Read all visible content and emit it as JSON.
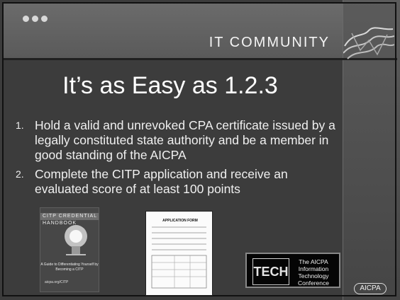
{
  "header": {
    "section_title": "IT COMMUNITY"
  },
  "slide": {
    "title": "It’s as Easy as 1.2.3",
    "items": [
      {
        "number": "1.",
        "text": "Hold a valid and unrevoked CPA certificate issued by a legally constituted state authority and be a member in good standing of the AICPA"
      },
      {
        "number": "2.",
        "text": "Complete the CITP application and receive an evaluated score of at least 100 points"
      }
    ]
  },
  "images": {
    "handbook": {
      "cover_title": "CITP CREDENTIAL HANDBOOK",
      "subtitle": "A Guide to Differentiating Yourself by Becoming a CITP",
      "footer": "aicpa.org/CITP"
    },
    "application_form": {
      "title": "APPLICATION FORM"
    },
    "tech_conference": {
      "logo_text": "TECH",
      "line1": "The AICPA",
      "line2": "Information",
      "line3": "Technology Conference"
    }
  },
  "footer": {
    "brand": "AICPA"
  }
}
